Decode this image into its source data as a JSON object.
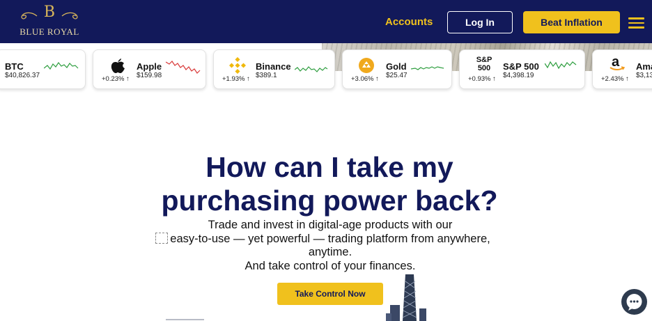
{
  "header": {
    "logo_letter": "B",
    "logo_text": "BLUE ROYAL",
    "nav_accounts": "Accounts",
    "login_label": "Log In",
    "beat_label": "Beat Inflation",
    "menu_icon": "hamburger-menu-icon"
  },
  "ticker": [
    {
      "name": "BTC",
      "price": "$40,826.37",
      "change": "",
      "trend": "up",
      "icon": ""
    },
    {
      "name": "Apple",
      "price": "$159.98",
      "change": "+0.23% ↑",
      "trend": "down",
      "icon": "apple-logo-icon"
    },
    {
      "name": "Binance",
      "price": "$389.1",
      "change": "+1.93% ↑",
      "trend": "up",
      "icon": "binance-logo-icon"
    },
    {
      "name": "Gold",
      "price": "$25.47",
      "change": "+3.06% ↑",
      "trend": "up",
      "icon": "gold-coin-icon"
    },
    {
      "name": "S&P 500",
      "price": "$4,398.19",
      "change": "+0.93% ↑",
      "trend": "up",
      "icon": "sp500-logo-icon",
      "icon_text": [
        "S&P",
        "500"
      ]
    },
    {
      "name": "Ama",
      "price": "$3,13",
      "change": "+2.43% ↑",
      "trend": "up",
      "icon": "amazon-logo-icon",
      "icon_text": [
        "a"
      ]
    }
  ],
  "hero": {
    "title_line1": "How can I take my",
    "title_line2": "purchasing power back?",
    "sub_line1": "Trade and invest in digital-age products with our",
    "sub_line2": "easy-to-use — yet powerful — trading platform from anywhere,",
    "sub_line3": "anytime.",
    "sub_line4": "And take control of your finances.",
    "cta_label": "Take Control Now"
  },
  "colors": {
    "navy": "#12195a",
    "gold": "#f0c11d",
    "spark_up": "#2e9e3f",
    "spark_down": "#d93a3a"
  },
  "chat_icon": "chat-bubble-icon"
}
